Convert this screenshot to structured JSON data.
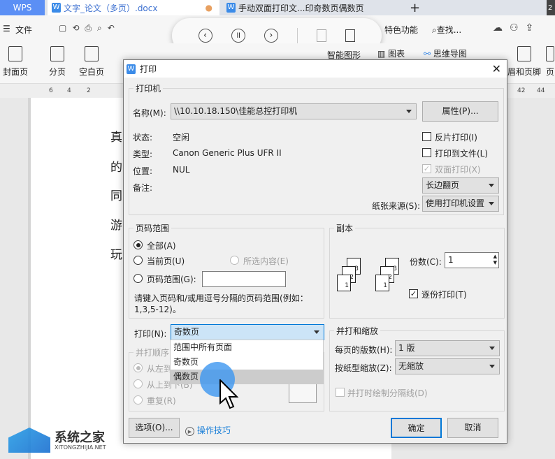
{
  "tabs": {
    "wps": "WPS",
    "doc1": "文字_论文（多页）.docx",
    "doc2": "手动双面打印文...印奇数页偶数页",
    "new": "+",
    "badge": "2"
  },
  "toolbar": {
    "file": "文件",
    "special": "特色功能",
    "find": "查找..."
  },
  "ribbon": {
    "cover": "封面页",
    "pagebreak": "分页",
    "blank": "空白页",
    "smartshape": "智能图形",
    "chart": "图表",
    "mindmap": "思维导图",
    "header": "眉和页脚",
    "page": "页"
  },
  "ruler": {
    "left": [
      "6",
      "4",
      "2"
    ],
    "right": [
      "42",
      "44"
    ]
  },
  "doc": {
    "chars": [
      "真",
      "的",
      "同",
      "游",
      "玩"
    ]
  },
  "dialog": {
    "title": "打印",
    "printer": {
      "group": "打印机",
      "name_label": "名称(M):",
      "name": "\\\\10.10.18.150\\佳能总控打印机",
      "properties": "属性(P)...",
      "status_label": "状态:",
      "status": "空闲",
      "type_label": "类型:",
      "type": "Canon Generic Plus UFR II",
      "location_label": "位置:",
      "location": "NUL",
      "comment_label": "备注:",
      "reverse": "反片打印(I)",
      "to_file": "打印到文件(L)",
      "duplex": "双面打印(X)",
      "flip": "长边翻页",
      "source_label": "纸张来源(S):",
      "source": "使用打印机设置"
    },
    "range": {
      "group": "页码范围",
      "all": "全部(A)",
      "current": "当前页(U)",
      "selection": "所选内容(E)",
      "pages": "页码范围(G):",
      "hint": "请键入页码和/或用逗号分隔的页码范围(例如：",
      "hint2": "1,3,5-12)。"
    },
    "copies": {
      "group": "副本",
      "count_label": "份数(C):",
      "count": "1",
      "collate": "逐份打印(T)"
    },
    "print": {
      "label": "打印(N):",
      "value": "奇数页",
      "options": [
        "范围中所有页面",
        "奇数页",
        "偶数页"
      ]
    },
    "order": {
      "group": "并打顺序",
      "ltr": "从左到右(F)",
      "ttb": "从上到下(B)",
      "repeat": "重复(R)"
    },
    "scale": {
      "group": "并打和缩放",
      "per_page_label": "每页的版数(H):",
      "per_page": "1 版",
      "scale_label": "按纸型缩放(Z):",
      "scale": "无缩放",
      "lines": "并打时绘制分隔线(D)"
    },
    "options": "选项(O)...",
    "tips": "操作技巧",
    "ok": "确定",
    "cancel": "取消"
  },
  "watermark": {
    "name": "系统之家",
    "url": "XITONGZHIJIA.NET"
  },
  "colors": {
    "accent": "#1a7fd8",
    "wps": "#5b8ff5"
  }
}
